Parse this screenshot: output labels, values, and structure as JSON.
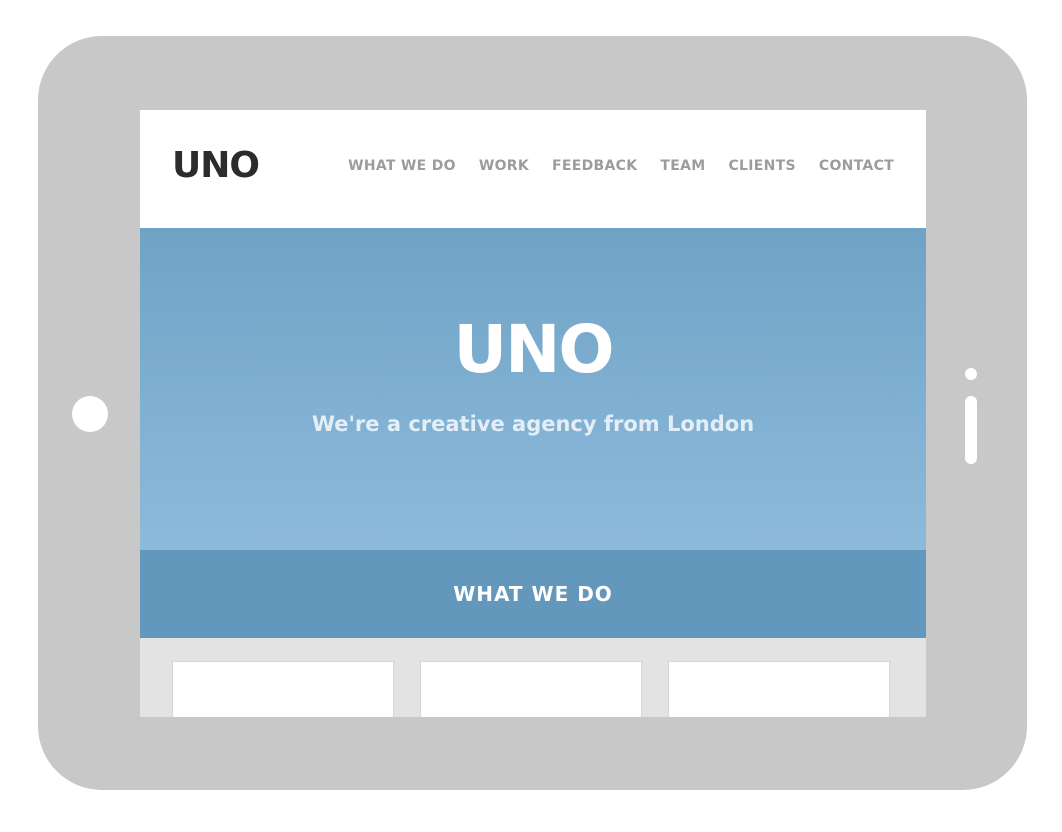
{
  "header": {
    "logo": "UNO",
    "nav": [
      "WHAT WE DO",
      "WORK",
      "FEEDBACK",
      "TEAM",
      "CLIENTS",
      "CONTACT"
    ]
  },
  "hero": {
    "title": "UNO",
    "subtitle": "We're a creative agency from London"
  },
  "section": {
    "title": "WHAT WE DO"
  },
  "colors": {
    "device_frame": "#c8c8c8",
    "hero_top": "#6fa3c6",
    "hero_bottom": "#8dbadb",
    "section_band": "#6397bb",
    "nav_text": "#9c9c9c",
    "logo_text": "#2c2c2c"
  }
}
